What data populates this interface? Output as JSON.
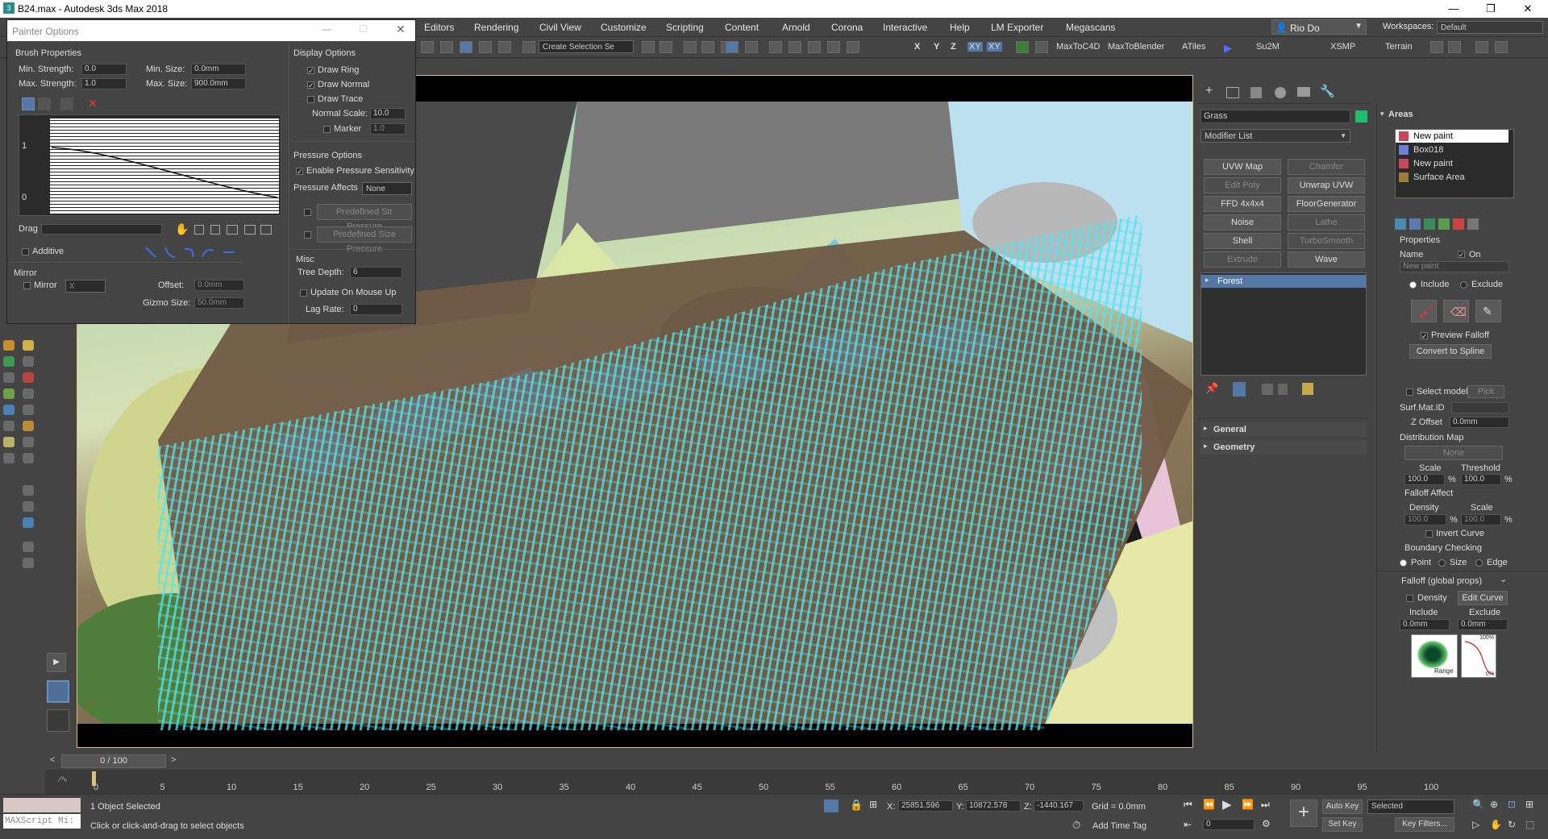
{
  "window": {
    "title": "B24.max - Autodesk 3ds Max 2018",
    "app_icon": "3ds-max-icon",
    "minimize": "—",
    "maximize": "❐",
    "close": "✕"
  },
  "menubar": {
    "items": [
      "Editors",
      "Rendering",
      "Civil View",
      "Customize",
      "Scripting",
      "Content",
      "Arnold",
      "Corona",
      "Interactive",
      "Help",
      "LM Exporter",
      "Megascans"
    ],
    "user": "Rio Do",
    "workspaces_label": "Workspaces:",
    "workspaces_value": "Default"
  },
  "toolbar": {
    "selection_set": "Create Selection Se",
    "axes": [
      "X",
      "Y",
      "Z",
      "XY",
      "XY"
    ],
    "plugins": [
      "MaxToC4D",
      "MaxToBlender",
      "ATiles",
      "Su2M",
      "XSMP",
      "Terrain"
    ]
  },
  "painter": {
    "title": "Painter Options",
    "brush_properties": "Brush Properties",
    "min_strength_label": "Min. Strength:",
    "min_strength": "0.0",
    "max_strength_label": "Max. Strength:",
    "max_strength": "1.0",
    "min_size_label": "Min. Size:",
    "min_size": "0.0mm",
    "max_size_label": "Max. Size:",
    "max_size": "900.0mm",
    "curve_y1": "1",
    "curve_y0": "0",
    "drag_label": "Drag",
    "additive": "Additive",
    "mirror_group": "Mirror",
    "mirror": "Mirror",
    "mirror_axis": "X",
    "offset_label": "Offset:",
    "offset": "0.0mm",
    "gizmo_size_label": "Gizmo Size:",
    "gizmo_size": "50.0mm",
    "display_options": "Display Options",
    "draw_ring": "Draw Ring",
    "draw_normal": "Draw Normal",
    "draw_trace": "Draw Trace",
    "normal_scale_label": "Normal Scale:",
    "normal_scale": "10.0",
    "marker": "Marker",
    "marker_val": "1.0",
    "pressure_options": "Pressure Options",
    "enable_pressure": "Enable Pressure Sensitivity",
    "pressure_affects_label": "Pressure Affects",
    "pressure_affects": "None",
    "predef_str": "Predefined Str Pressure",
    "predef_size": "Predefined Size Pressure",
    "misc": "Misc",
    "tree_depth_label": "Tree Depth:",
    "tree_depth": "6",
    "update_on_mouse_up": "Update On Mouse Up",
    "lag_rate_label": "Lag Rate:",
    "lag_rate": "0"
  },
  "command_panel": {
    "object_name": "Grass",
    "object_color": "#1fbf6a",
    "modifier_list": "Modifier List",
    "modifiers": [
      "UVW Map",
      "Chamfer",
      "Edit Poly",
      "Unwrap UVW",
      "FFD 4x4x4",
      "FloorGenerator",
      "Noise",
      "Lathe",
      "Shell",
      "TurboSmooth",
      "Extrude",
      "Wave"
    ],
    "stack_item": "Forest",
    "rollouts": [
      "General",
      "Geometry"
    ]
  },
  "areas": {
    "title": "Areas",
    "items": [
      {
        "label": "New paint",
        "selected": true
      },
      {
        "label": "Box018"
      },
      {
        "label": "New paint"
      },
      {
        "label": "Surface Area"
      }
    ],
    "properties": "Properties",
    "name_label": "Name",
    "on_label": "On",
    "name_value": "New paint",
    "include": "Include",
    "exclude": "Exclude",
    "preview_falloff": "Preview Falloff",
    "convert_to_spline": "Convert to Spline",
    "select_models": "Select models",
    "pick": "Pick",
    "surf_mat_id": "Surf.Mat.ID",
    "z_offset_label": "Z Offset",
    "z_offset": "0.0mm",
    "distribution_map": "Distribution Map",
    "dist_none": "None",
    "scale_label": "Scale",
    "threshold_label": "Threshold",
    "scale_value": "100.0",
    "threshold_value": "100.0",
    "pct": "%",
    "falloff_affect": "Falloff Affect",
    "density_label": "Density",
    "fa_scale_label": "Scale",
    "fa_density": "100.0",
    "fa_scale": "100.0",
    "invert_curve": "Invert Curve",
    "boundary_checking": "Boundary Checking",
    "bc_point": "Point",
    "bc_size": "Size",
    "bc_edge": "Edge",
    "falloff_global": "Falloff (global props)",
    "density": "Density",
    "edit_curve": "Edit Curve",
    "fg_include": "Include",
    "fg_exclude": "Exclude",
    "fg_inc_val": "0.0mm",
    "fg_exc_val": "0.0mm",
    "falloff_pct": "100%",
    "falloff_0": "0%",
    "range_label": "Range"
  },
  "timeline": {
    "frame": "0 / 100",
    "ticks": [
      "0",
      "5",
      "10",
      "15",
      "20",
      "25",
      "30",
      "35",
      "40",
      "45",
      "50",
      "55",
      "60",
      "65",
      "70",
      "75",
      "80",
      "85",
      "90",
      "95",
      "100"
    ]
  },
  "status": {
    "script": "MAXScript Mi:",
    "selected": "1 Object Selected",
    "prompt": "Click or click-and-drag to select objects",
    "x_label": "X:",
    "x": "25851.596",
    "y_label": "Y:",
    "y": "10872.578",
    "z_label": "Z:",
    "z": "-1440.167",
    "grid": "Grid = 0.0mm",
    "add_time_tag": "Add Time Tag",
    "auto_key": "Auto Key",
    "set_key": "Set Key",
    "key_mode": "Selected",
    "key_filters": "Key Filters...",
    "frame_value": "0"
  }
}
